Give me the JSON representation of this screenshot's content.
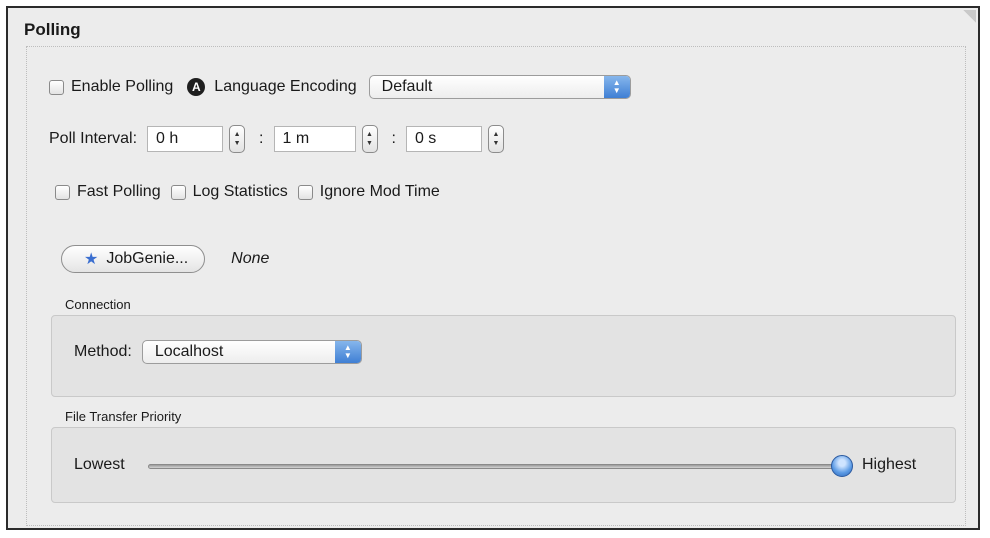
{
  "panel": {
    "title": "Polling"
  },
  "polling": {
    "enable_label": "Enable Polling",
    "encoding_label": "Language Encoding",
    "encoding_value": "Default",
    "interval_label": "Poll Interval:",
    "hours": "0 h",
    "minutes": "1 m",
    "seconds": "0 s",
    "colon": ":",
    "fast_label": "Fast Polling",
    "log_label": "Log Statistics",
    "ignore_label": "Ignore Mod Time",
    "a_icon_glyph": "A"
  },
  "jobgenie": {
    "button_label": "JobGenie...",
    "value": "None"
  },
  "connection": {
    "group_label": "Connection",
    "method_label": "Method:",
    "method_value": "Localhost"
  },
  "priority": {
    "group_label": "File Transfer Priority",
    "low_label": "Lowest",
    "high_label": "Highest",
    "level": 1.0
  },
  "colors": {
    "accent": "#3f7fd4",
    "background": "#ececec"
  }
}
